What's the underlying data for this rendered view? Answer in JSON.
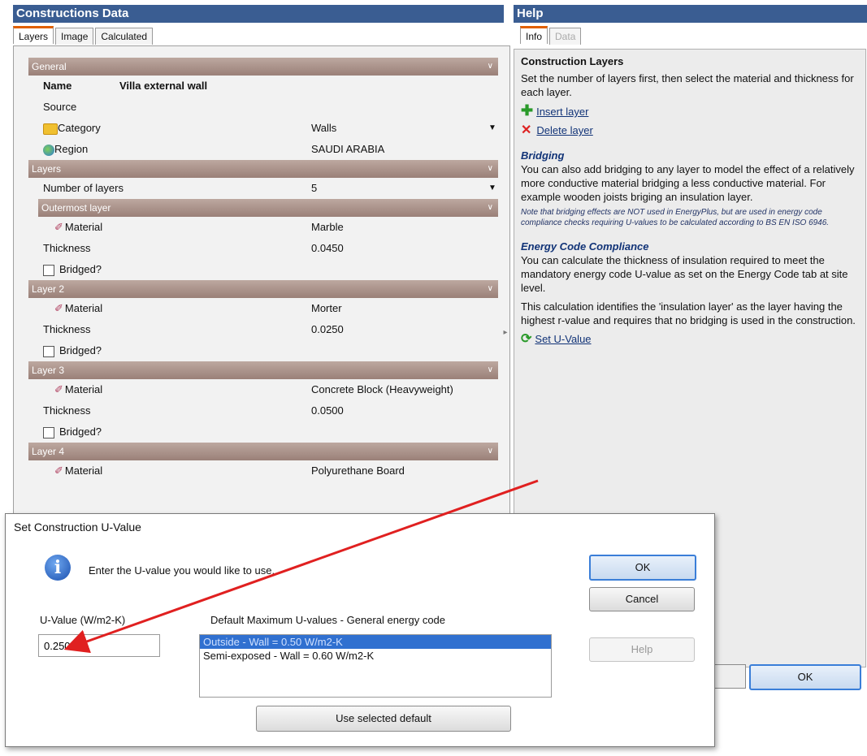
{
  "constructions_pane": {
    "title": "Constructions Data",
    "tabs": [
      "Layers",
      "Image",
      "Calculated"
    ],
    "general": {
      "header": "General",
      "name_label": "Name",
      "name_value": "Villa external wall",
      "source_label": "Source",
      "category_label": "Category",
      "category_value": "Walls",
      "region_label": "Region",
      "region_value": "SAUDI ARABIA"
    },
    "layers": {
      "header": "Layers",
      "num_label": "Number of layers",
      "num_value": "5",
      "items": [
        {
          "header": "Outermost layer",
          "material_label": "Material",
          "material": "Marble",
          "thickness_label": "Thickness",
          "thickness": "0.0450",
          "bridged_label": "Bridged?"
        },
        {
          "header": "Layer 2",
          "material_label": "Material",
          "material": "Morter",
          "thickness_label": "Thickness",
          "thickness": "0.0250",
          "bridged_label": "Bridged?"
        },
        {
          "header": "Layer 3",
          "material_label": "Material",
          "material": "Concrete Block (Heavyweight)",
          "thickness_label": "Thickness",
          "thickness": "0.0500",
          "bridged_label": "Bridged?"
        },
        {
          "header": "Layer 4",
          "material_label": "Material",
          "material": "Polyurethane Board"
        }
      ]
    }
  },
  "help_pane": {
    "title": "Help",
    "tabs": [
      "Info",
      "Data"
    ],
    "heading": "Construction Layers",
    "intro": "Set the number of layers first, then select the material and thickness for each layer.",
    "insert_link": "Insert layer",
    "delete_link": "Delete layer",
    "bridging_heading": "Bridging",
    "bridging_text": "You can also add bridging to any layer to model the effect of a relatively more conductive material bridging a less conductive material.  For example wooden joists briging an insulation layer.",
    "bridging_note": "Note that bridging effects are NOT used in EnergyPlus, but are used in energy code compliance checks requiring U-values to be calculated according to BS EN ISO 6946.",
    "energy_heading": "Energy Code Compliance",
    "energy_text": "You can calculate the thickness of insulation required to meet the mandatory energy code U-value as set on the Energy Code tab at site level.",
    "energy_text2": "This calculation identifies the 'insulation layer' as the layer having the highest r-value and requires that no bridging is used in the construction.",
    "set_uvalue_link": "Set U-Value"
  },
  "main_ok": "OK",
  "dialog": {
    "title": "Set Construction U-Value",
    "prompt": "Enter the U-value you would like to use.",
    "uvalue_label": "U-Value (W/m2-K)",
    "uvalue": "0.2500",
    "defaults_label": "Default Maximum U-values - General energy code",
    "defaults": [
      "Outside - Wall = 0.50 W/m2-K",
      "Semi-exposed - Wall = 0.60 W/m2-K"
    ],
    "selected_index": 0,
    "ok": "OK",
    "cancel": "Cancel",
    "help": "Help",
    "use_default": "Use selected default"
  },
  "colors": {
    "title_bar": "#3a5d92",
    "section_header": "#a98e86",
    "selection": "#3070d0",
    "annotation_arrow": "#e02020"
  }
}
